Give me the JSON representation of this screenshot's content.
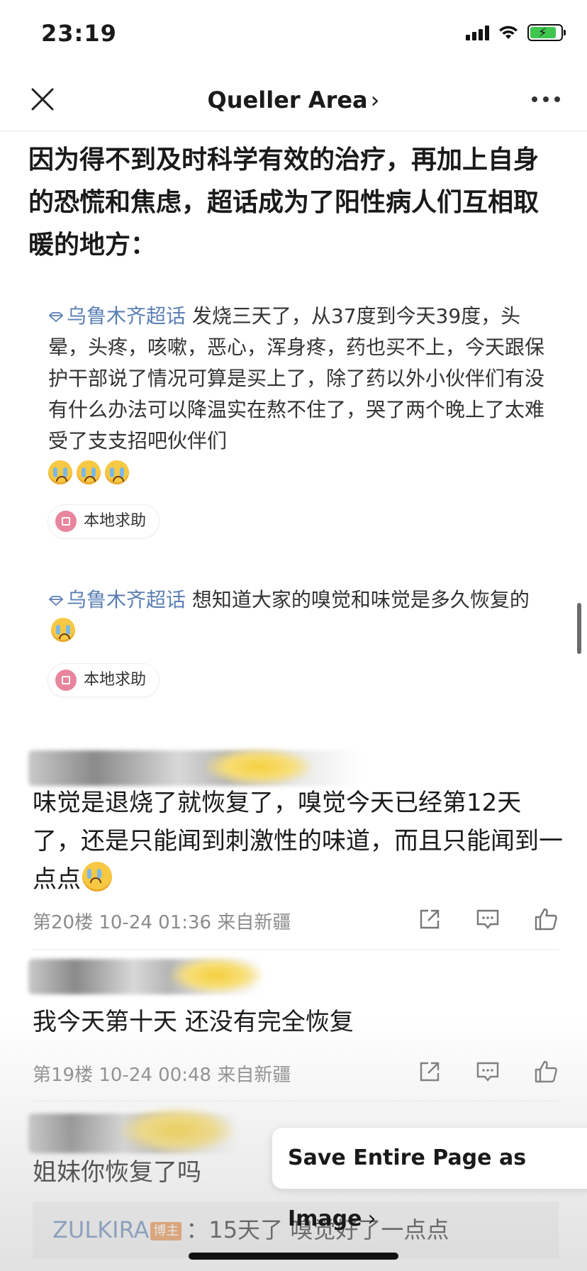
{
  "status_bar": {
    "time": "23:19"
  },
  "nav": {
    "title": "Queller Area",
    "title_chevron": "›"
  },
  "headline": "因为得不到及时科学有效的治疗，再加上自身的恐慌和焦虑，超话成为了阳性病人们互相取暖的地方：",
  "posts": [
    {
      "tag": "乌鲁木齐超话",
      "text": " 发烧三天了，从37度到今天39度，头晕，头疼，咳嗽，恶心，浑身疼，药也买不上，今天跟保护干部说了情况可算是买上了，除了药以外小伙伴们有没有什么办法可以降温实在熬不住了，哭了两个晚上了太难受了支支招吧伙伴们",
      "chip_label": "本地求助"
    },
    {
      "tag": "乌鲁木齐超话",
      "text": " 想知道大家的嗅觉和味觉是多久恢复的",
      "chip_label": "本地求助"
    }
  ],
  "comments": [
    {
      "text": "味觉是退烧了就恢复了，嗅觉今天已经第12天了，还是只能闻到刺激性的味道，而且只能闻到一点点",
      "meta": "第20楼 10-24 01:36 来自新疆"
    },
    {
      "text": "我今天第十天 还没有完全恢复",
      "meta": "第19楼 10-24 00:48 来自新疆"
    },
    {
      "text": "姐妹你恢复了吗"
    }
  ],
  "reply": {
    "user": "ZULKIRA",
    "badge": "博主",
    "text": "：15天了 嗅觉好了一点点"
  },
  "save_button": {
    "label": "Save Entire Page as Image",
    "chevron": "›"
  },
  "colors": {
    "tag_blue": "#5a7fb5",
    "battery_green": "#3fc64f",
    "chip_pink": "#e8859d",
    "badge_orange": "#e9873a"
  }
}
